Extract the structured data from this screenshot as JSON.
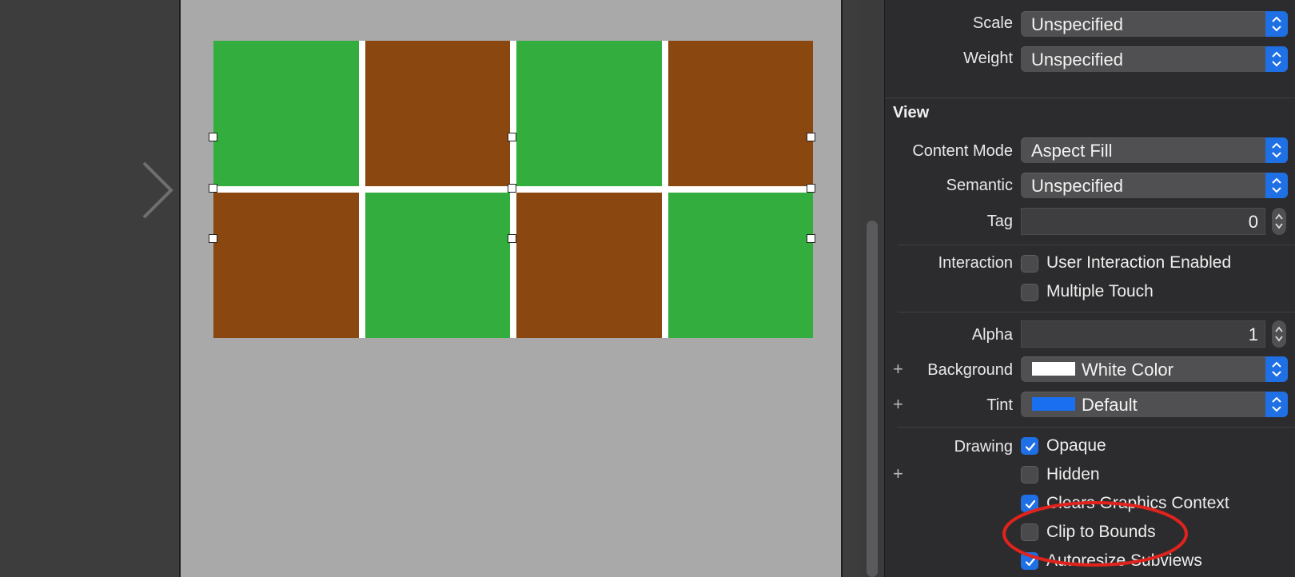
{
  "canvas": {
    "grid": {
      "rows": [
        [
          "green",
          "brown",
          "green",
          "brown"
        ],
        [
          "brown",
          "green",
          "brown",
          "green"
        ]
      ],
      "colors": {
        "green": "#33ae3e",
        "brown": "#8b4710",
        "gap": "#ffffff"
      }
    }
  },
  "inspector": {
    "font_rows": [
      {
        "label": "Scale",
        "value": "Unspecified"
      },
      {
        "label": "Weight",
        "value": "Unspecified"
      }
    ],
    "view_section": {
      "title": "View",
      "content_mode": {
        "label": "Content Mode",
        "value": "Aspect Fill"
      },
      "semantic": {
        "label": "Semantic",
        "value": "Unspecified"
      },
      "tag": {
        "label": "Tag",
        "value": "0"
      },
      "interaction": {
        "label": "Interaction",
        "options": [
          {
            "label": "User Interaction Enabled",
            "checked": false
          },
          {
            "label": "Multiple Touch",
            "checked": false
          }
        ]
      },
      "alpha": {
        "label": "Alpha",
        "value": "1"
      },
      "background": {
        "label": "Background",
        "value": "White Color",
        "swatch": "#ffffff"
      },
      "tint": {
        "label": "Tint",
        "value": "Default",
        "swatch": "#1a6ff0"
      },
      "drawing": {
        "label": "Drawing",
        "options": [
          {
            "label": "Opaque",
            "checked": true
          },
          {
            "label": "Hidden",
            "checked": false
          },
          {
            "label": "Clears Graphics Context",
            "checked": true
          },
          {
            "label": "Clip to Bounds",
            "checked": false
          },
          {
            "label": "Autoresize Subviews",
            "checked": true
          }
        ]
      },
      "plus_symbol": "+"
    },
    "accent_color": "#1f6fe5",
    "highlight_color": "#e0231c"
  }
}
